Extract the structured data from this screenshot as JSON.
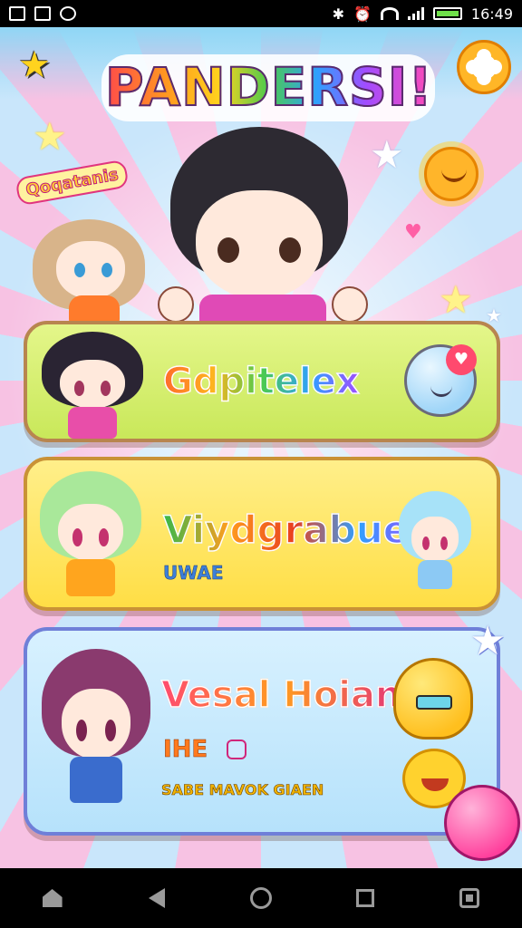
{
  "status_bar": {
    "time": "16:49"
  },
  "game": {
    "title": "PANDERSI!",
    "side_badge": "Qoqatanis"
  },
  "cards": [
    {
      "title": "Gdpitelex"
    },
    {
      "title": "Viydgrabue.",
      "subtitle": "UWAE"
    },
    {
      "title": "Vesal Hoian",
      "subtitle": "IHE",
      "tagline": "SABE MAVOK GIAEN"
    }
  ],
  "icons": {
    "top_left": "star-icon",
    "top_right": "settings-icon",
    "nav": [
      "home-icon",
      "back-icon",
      "circle-home-icon",
      "recents-icon",
      "app-switch-icon"
    ]
  },
  "colors": {
    "card1": "#d6ee6e",
    "card2": "#ffe455",
    "card3": "#c7e9fd",
    "settings_button": "#ffb627"
  }
}
